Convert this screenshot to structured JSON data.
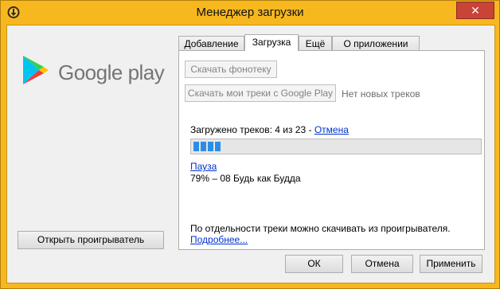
{
  "window": {
    "title": "Менеджер загрузки",
    "close_glyph": "✕"
  },
  "logo": {
    "text": "Google play"
  },
  "tabs": [
    {
      "label": "Добавление",
      "active": false
    },
    {
      "label": "Загрузка",
      "active": true
    },
    {
      "label": "Ещё",
      "active": false
    },
    {
      "label": "О приложении",
      "active": false
    }
  ],
  "download": {
    "download_library_label": "Скачать фонотеку",
    "download_my_tracks_label": "Скачать мои треки с Google Play",
    "no_new_tracks": "Нет новых треков",
    "loaded_prefix": "Загружено треков: 4 из 23 - ",
    "cancel_link": "Отмена",
    "progress_fraction": 0.1,
    "pause_link": "Пауза",
    "current_track": "79% – 08 Будь как Будда",
    "hint_text": "По отдельности треки можно скачивать из проигрывателя.",
    "more_link": "Подробнее..."
  },
  "sidebar": {
    "open_player_label": "Открыть проигрыватель"
  },
  "footer": {
    "ok_label": "ОК",
    "cancel_label": "Отмена",
    "apply_label": "Применить"
  },
  "colors": {
    "frame": "#f6b81e",
    "progress": "#2b8ee6",
    "link": "#0033cc",
    "close": "#c74437"
  }
}
